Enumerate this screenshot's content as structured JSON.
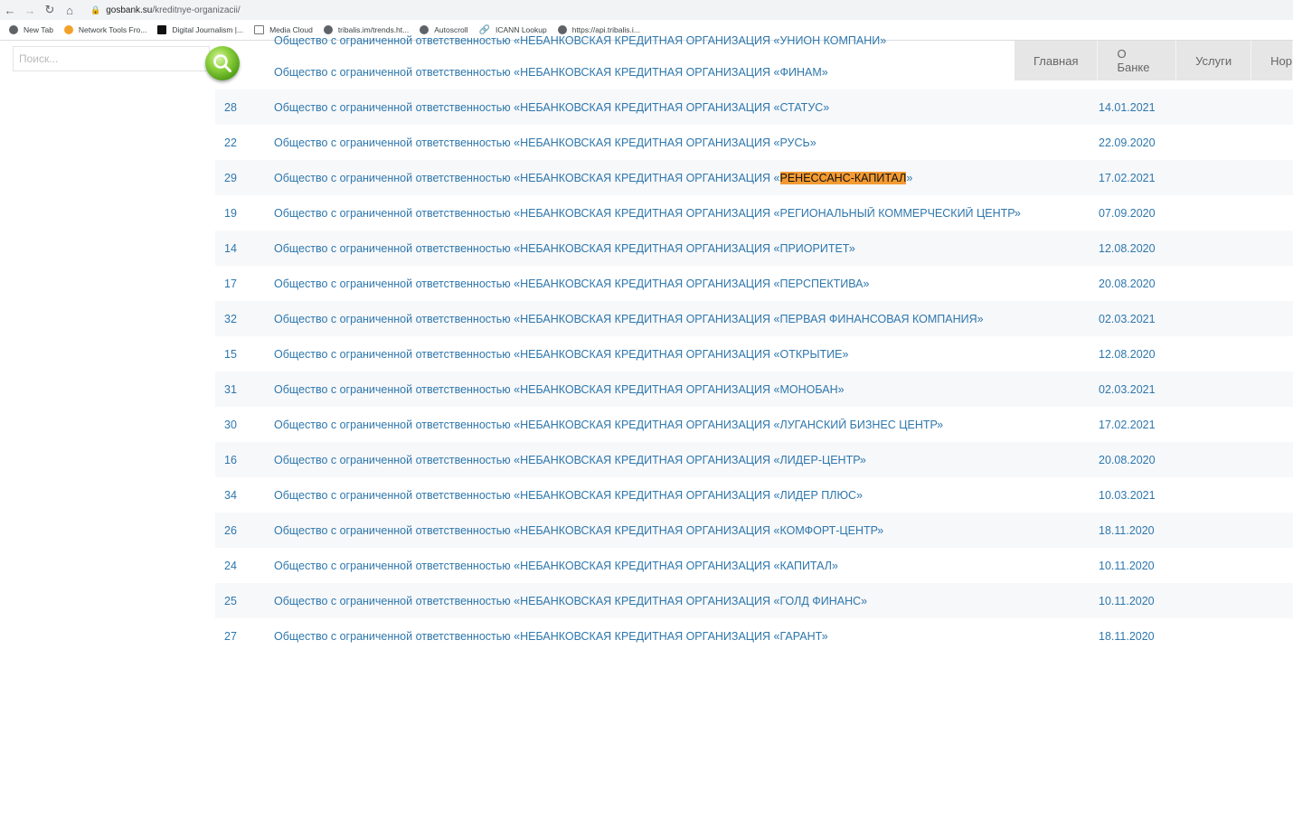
{
  "browser": {
    "url_host": "gosbank.su",
    "url_path": "/kreditnye-organizacii/",
    "bookmarks": [
      {
        "label": "New Tab",
        "icon": "globe-icon"
      },
      {
        "label": "Network Tools Fro...",
        "icon": "orange-x-icon"
      },
      {
        "label": "Digital Journalism |...",
        "icon": "black-square-icon"
      },
      {
        "label": "Media Cloud",
        "icon": "window-icon"
      },
      {
        "label": "tribalis.im/trends.ht...",
        "icon": "globe-icon"
      },
      {
        "label": "Autoscroll",
        "icon": "globe-icon"
      },
      {
        "label": "ICANN Lookup",
        "icon": "link-icon"
      },
      {
        "label": "https://api.tribalis.i...",
        "icon": "globe-icon"
      }
    ]
  },
  "search": {
    "placeholder": "Поиск..."
  },
  "nav": {
    "items": [
      "Главная",
      "О Банке",
      "Услуги",
      "Нор"
    ]
  },
  "table": {
    "partial_row": {
      "name": "Общество с ограниченной ответственностью «НЕБАНКОВСКАЯ КРЕДИТНАЯ ОРГАНИЗАЦИЯ «УНИОН КОМПАНИ»"
    },
    "rows": [
      {
        "num": "",
        "prefix": "Общество с ограниченной ответственностью «НЕБАНКОВСКАЯ КРЕДИТНАЯ ОРГАНИЗАЦИЯ  «ФИНАМ»",
        "highlight": "",
        "suffix": "",
        "date": ""
      },
      {
        "num": "28",
        "prefix": "Общество с ограниченной ответственностью «НЕБАНКОВСКАЯ КРЕДИТНАЯ ОРГАНИЗАЦИЯ  «СТАТУС»",
        "highlight": "",
        "suffix": "",
        "date": "14.01.2021"
      },
      {
        "num": "22",
        "prefix": "Общество с ограниченной ответственностью «НЕБАНКОВСКАЯ КРЕДИТНАЯ ОРГАНИЗАЦИЯ  «РУСЬ»",
        "highlight": "",
        "suffix": "",
        "date": "22.09.2020"
      },
      {
        "num": "29",
        "prefix": "Общество с ограниченной ответственностью «НЕБАНКОВСКАЯ КРЕДИТНАЯ ОРГАНИЗАЦИЯ «",
        "highlight": "РЕНЕССАНС-КАПИТАЛ",
        "suffix": "»",
        "date": "17.02.2021"
      },
      {
        "num": "19",
        "prefix": "Общество с ограниченной ответственностью «НЕБАНКОВСКАЯ КРЕДИТНАЯ ОРГАНИЗАЦИЯ  «РЕГИОНАЛЬНЫЙ  КОММЕРЧЕСКИЙ ЦЕНТР»",
        "highlight": "",
        "suffix": "",
        "date": "07.09.2020"
      },
      {
        "num": "14",
        "prefix": "Общество с ограниченной ответственностью «НЕБАНКОВСКАЯ КРЕДИТНАЯ ОРГАНИЗАЦИЯ  «ПРИОРИТЕТ»",
        "highlight": "",
        "suffix": "",
        "date": "12.08.2020"
      },
      {
        "num": "17",
        "prefix": "Общество с ограниченной ответственностью «НЕБАНКОВСКАЯ КРЕДИТНАЯ ОРГАНИЗАЦИЯ  «ПЕРСПЕКТИВА»",
        "highlight": "",
        "suffix": "",
        "date": "20.08.2020"
      },
      {
        "num": "32",
        "prefix": "Общество с ограниченной ответственностью «НЕБАНКОВСКАЯ КРЕДИТНАЯ ОРГАНИЗАЦИЯ «ПЕРВАЯ ФИНАНСОВАЯ КОМПАНИЯ»",
        "highlight": "",
        "suffix": "",
        "date": "02.03.2021"
      },
      {
        "num": "15",
        "prefix": "Общество с ограниченной ответственностью «НЕБАНКОВСКАЯ КРЕДИТНАЯ ОРГАНИЗАЦИЯ  «ОТКРЫТИЕ»",
        "highlight": "",
        "suffix": "",
        "date": "12.08.2020"
      },
      {
        "num": "31",
        "prefix": "Общество с ограниченной ответственностью «НЕБАНКОВСКАЯ КРЕДИТНАЯ ОРГАНИЗАЦИЯ «МОНОБАН»",
        "highlight": "",
        "suffix": "",
        "date": "02.03.2021"
      },
      {
        "num": "30",
        "prefix": "Общество с ограниченной ответственностью «НЕБАНКОВСКАЯ КРЕДИТНАЯ ОРГАНИЗАЦИЯ «ЛУГАНСКИЙ БИЗНЕС ЦЕНТР»",
        "highlight": "",
        "suffix": "",
        "date": "17.02.2021"
      },
      {
        "num": "16",
        "prefix": "Общество с ограниченной ответственностью «НЕБАНКОВСКАЯ КРЕДИТНАЯ ОРГАНИЗАЦИЯ  «ЛИДЕР-ЦЕНТР»",
        "highlight": "",
        "suffix": "",
        "date": "20.08.2020"
      },
      {
        "num": "34",
        "prefix": "Общество с ограниченной ответственностью «НЕБАНКОВСКАЯ КРЕДИТНАЯ ОРГАНИЗАЦИЯ «ЛИДЕР ПЛЮС»",
        "highlight": "",
        "suffix": "",
        "date": "10.03.2021"
      },
      {
        "num": "26",
        "prefix": "Общество с ограниченной ответственностью «НЕБАНКОВСКАЯ КРЕДИТНАЯ ОРГАНИЗАЦИЯ «КОМФОРТ-ЦЕНТР»",
        "highlight": "",
        "suffix": "",
        "date": "18.11.2020"
      },
      {
        "num": "24",
        "prefix": "Общество с ограниченной ответственностью «НЕБАНКОВСКАЯ КРЕДИТНАЯ ОРГАНИЗАЦИЯ «КАПИТАЛ»",
        "highlight": "",
        "suffix": "",
        "date": "10.11.2020"
      },
      {
        "num": "25",
        "prefix": "Общество с ограниченной ответственностью «НЕБАНКОВСКАЯ КРЕДИТНАЯ ОРГАНИЗАЦИЯ «ГОЛД ФИНАНС»",
        "highlight": "",
        "suffix": "",
        "date": "10.11.2020"
      },
      {
        "num": "27",
        "prefix": "Общество с ограниченной ответственностью «НЕБАНКОВСКАЯ КРЕДИТНАЯ ОРГАНИЗАЦИЯ «ГАРАНТ»",
        "highlight": "",
        "suffix": "",
        "date": "18.11.2020"
      }
    ]
  },
  "colors": {
    "link": "#2e77ac",
    "highlight": "#f39a33",
    "nav_bg": "#e6e6e6"
  }
}
